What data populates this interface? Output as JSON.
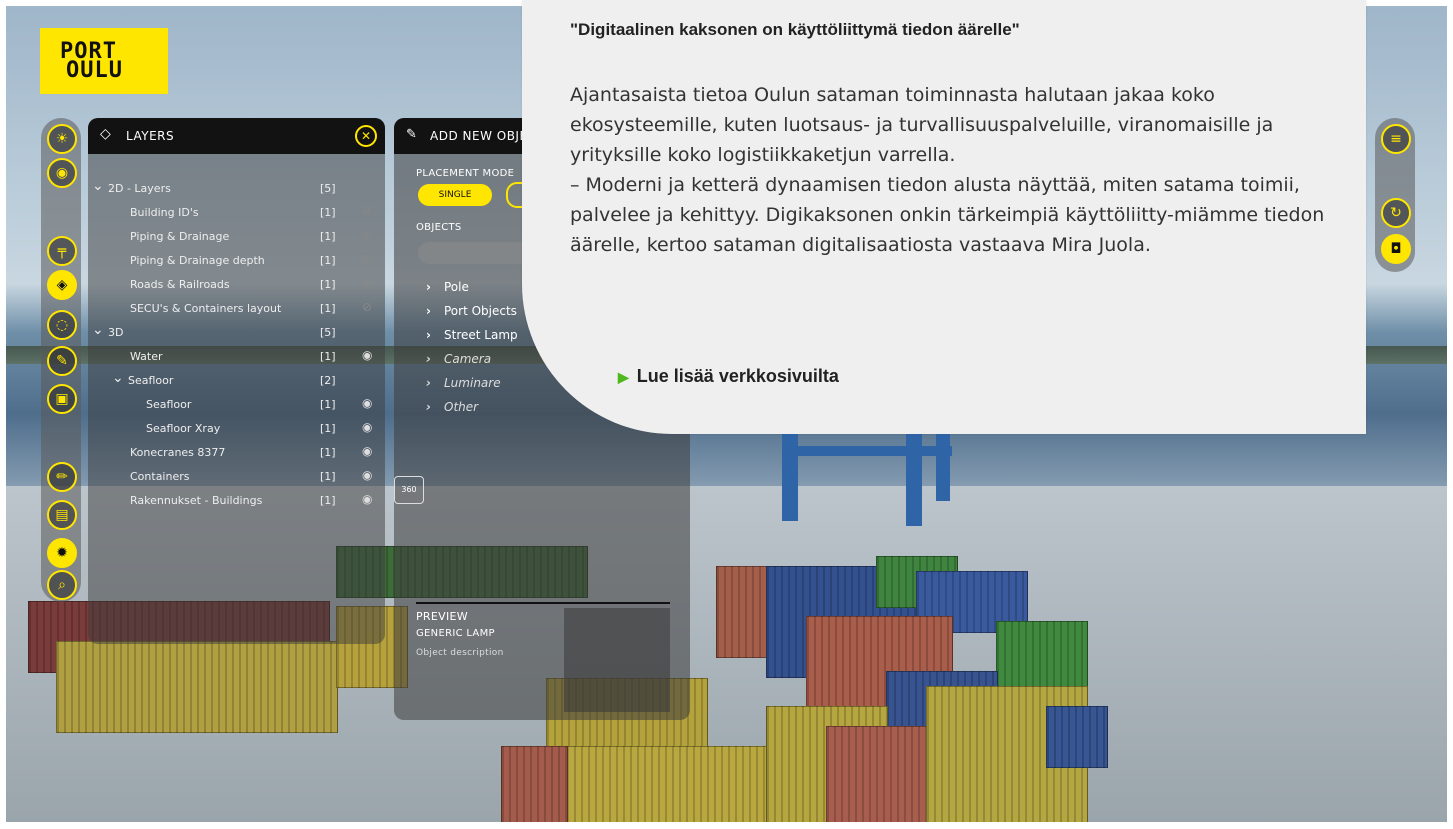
{
  "logo": {
    "line1": "PORT",
    "line2": "OULU",
    "color": "#ffe600"
  },
  "accent_color": "#ffe600",
  "toolbar": {
    "items": [
      {
        "icon": "sun-cloud-icon"
      },
      {
        "icon": "camera-icon"
      },
      {
        "icon": "crane-icon"
      },
      {
        "icon": "layers-icon",
        "active": true
      },
      {
        "icon": "network-icon"
      },
      {
        "icon": "wrench-icon"
      },
      {
        "icon": "video-camera-icon"
      },
      {
        "icon": "pencil-icon"
      },
      {
        "icon": "document-icon"
      },
      {
        "icon": "settings-gear-icon"
      },
      {
        "icon": "zoom-search-icon"
      }
    ]
  },
  "layers_panel": {
    "title": "LAYERS",
    "rows": [
      {
        "name": "2D - Layers",
        "count": "[5]",
        "group": true,
        "indent": 0,
        "eye": ""
      },
      {
        "name": "Building ID's",
        "count": "[1]",
        "indent": 1,
        "eye": "hidden"
      },
      {
        "name": "Piping & Drainage",
        "count": "[1]",
        "indent": 1,
        "eye": "hidden"
      },
      {
        "name": "Piping & Drainage depth",
        "count": "[1]",
        "indent": 1,
        "eye": "hidden"
      },
      {
        "name": "Roads & Railroads",
        "count": "[1]",
        "indent": 1,
        "eye": "hidden"
      },
      {
        "name": "SECU's & Containers layout",
        "count": "[1]",
        "indent": 1,
        "eye": "hidden"
      },
      {
        "name": "3D",
        "count": "[5]",
        "group": true,
        "indent": 0,
        "eye": ""
      },
      {
        "name": "Water",
        "count": "[1]",
        "indent": 1,
        "eye": "visible"
      },
      {
        "name": "Seafloor",
        "count": "[2]",
        "group": true,
        "indent": 1,
        "eye": ""
      },
      {
        "name": "Seafloor",
        "count": "[1]",
        "indent": 2,
        "eye": "visible"
      },
      {
        "name": "Seafloor Xray",
        "count": "[1]",
        "indent": 2,
        "eye": "visible"
      },
      {
        "name": "Konecranes 8377",
        "count": "[1]",
        "indent": 1,
        "eye": "visible"
      },
      {
        "name": "Containers",
        "count": "[1]",
        "indent": 1,
        "eye": "visible"
      },
      {
        "name": "Rakennukset - Buildings",
        "count": "[1]",
        "indent": 1,
        "eye": "visible"
      }
    ]
  },
  "add_object_panel": {
    "title": "ADD NEW OBJECT",
    "placement_mode_label": "PLACEMENT MODE",
    "mode_single": "SINGLE",
    "objects_label": "OBJECTS",
    "objects": [
      {
        "label": "Pole",
        "italic": false
      },
      {
        "label": "Port Objects",
        "italic": false
      },
      {
        "label": "Street Lamp",
        "italic": false
      },
      {
        "label": "Camera",
        "italic": true
      },
      {
        "label": "Luminare",
        "italic": true
      },
      {
        "label": "Other",
        "italic": true
      }
    ],
    "preview_label": "PREVIEW",
    "preview_name": "GENERIC LAMP",
    "preview_desc": "Object description"
  },
  "badge_360": "360",
  "card": {
    "heading": "\"Digitaalinen kaksonen on käyttöliittymä tiedon äärelle\"",
    "paragraph1": "Ajantasaista tietoa Oulun sataman toiminnasta halutaan jakaa koko ekosysteemille, kuten luotsaus- ja turvallisuuspalveluille, viranomaisille ja yrityksille koko logistiikkaketjun varrella.",
    "paragraph2": "– Moderni ja ketterä dynaamisen tiedon alusta näyttää, miten satama toimii, palvelee ja kehittyy. Digikaksonen onkin tärkeimpiä käyttöliitty-miämme tiedon äärelle, kertoo sataman digitalisaatiosta vastaava Mira Juola.",
    "link": "Lue lisää verkkosivuilta",
    "link_marker_color": "#4fb81f"
  },
  "right_toolbar": {
    "items": [
      {
        "icon": "hamburger-menu-icon"
      },
      {
        "icon": "reset-rotate-icon"
      },
      {
        "icon": "record-camera-icon",
        "active": true
      }
    ]
  }
}
